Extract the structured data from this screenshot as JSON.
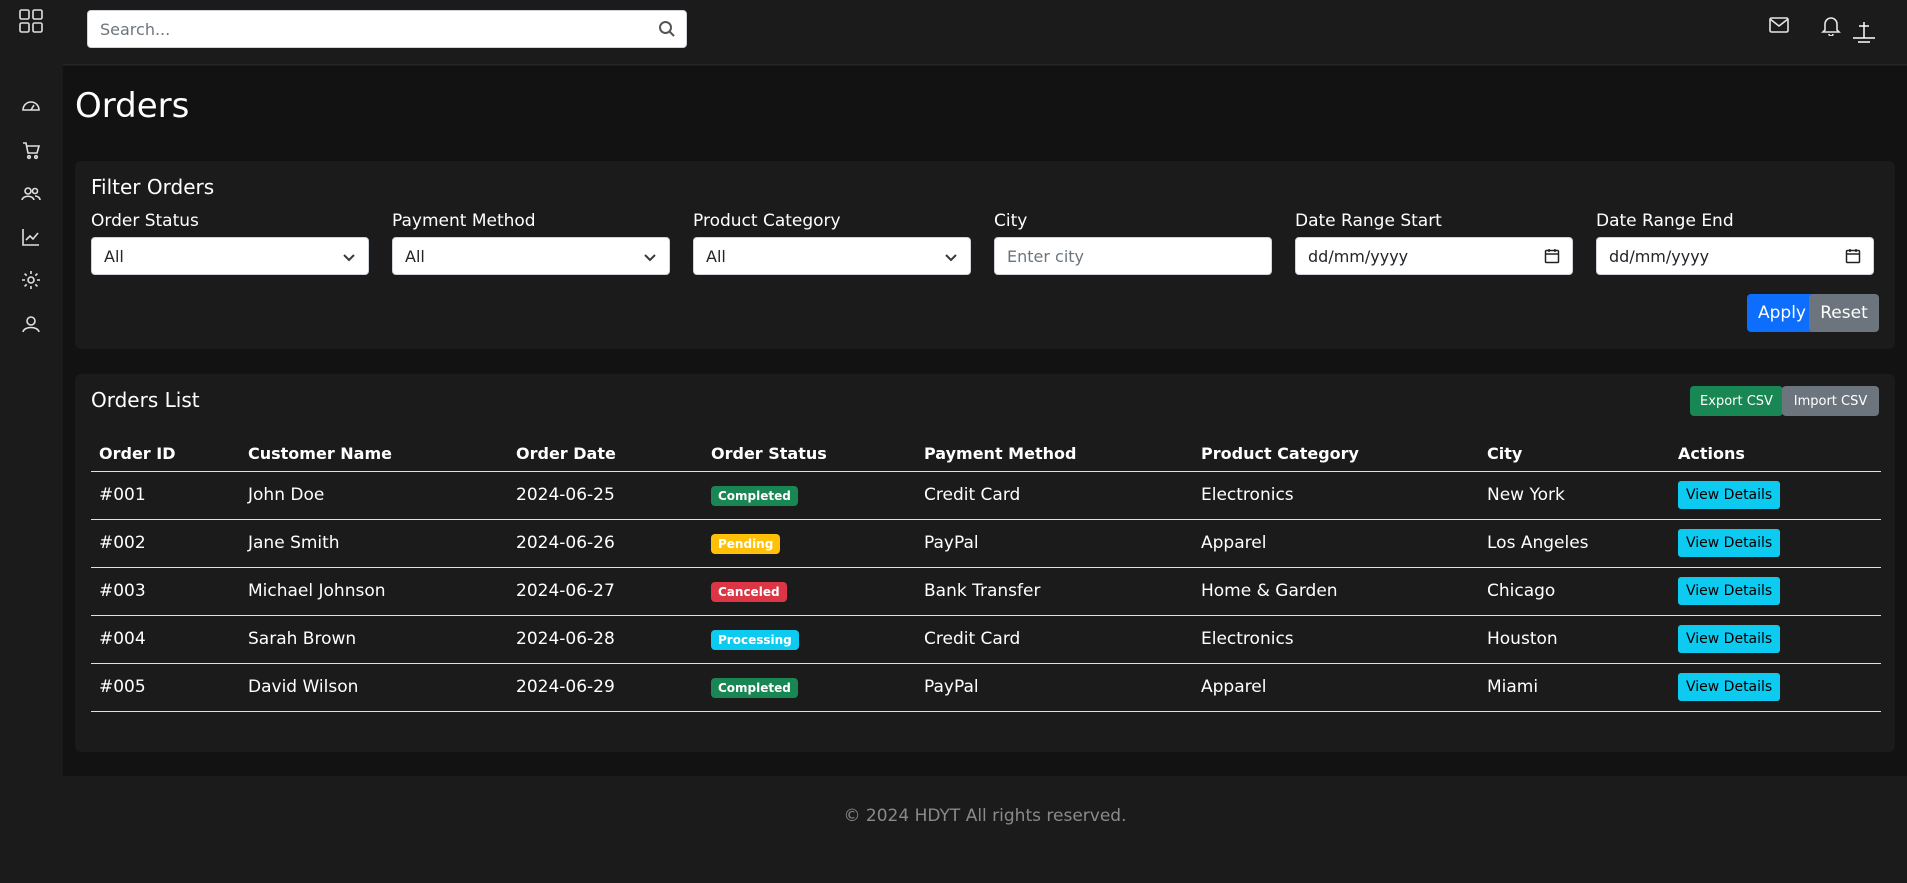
{
  "search": {
    "placeholder": "Search..."
  },
  "page": {
    "title": "Orders"
  },
  "filters": {
    "title": "Filter Orders",
    "order_status": {
      "label": "Order Status",
      "value": "All"
    },
    "payment_method": {
      "label": "Payment Method",
      "value": "All"
    },
    "product_category": {
      "label": "Product Category",
      "value": "All"
    },
    "city": {
      "label": "City",
      "placeholder": "Enter city"
    },
    "date_start": {
      "label": "Date Range Start",
      "placeholder": "dd/mm/yyyy"
    },
    "date_end": {
      "label": "Date Range End",
      "placeholder": "dd/mm/yyyy"
    },
    "apply_label": "Apply",
    "reset_label": "Reset"
  },
  "orders": {
    "title": "Orders List",
    "export_label": "Export CSV",
    "import_label": "Import CSV",
    "columns": [
      "Order ID",
      "Customer Name",
      "Order Date",
      "Order Status",
      "Payment Method",
      "Product Category",
      "City",
      "Actions"
    ],
    "rows": [
      {
        "id": "#001",
        "customer": "John Doe",
        "date": "2024-06-25",
        "status": "Completed",
        "payment": "Credit Card",
        "category": "Electronics",
        "city": "New York",
        "action": "View Details"
      },
      {
        "id": "#002",
        "customer": "Jane Smith",
        "date": "2024-06-26",
        "status": "Pending",
        "payment": "PayPal",
        "category": "Apparel",
        "city": "Los Angeles",
        "action": "View Details"
      },
      {
        "id": "#003",
        "customer": "Michael Johnson",
        "date": "2024-06-27",
        "status": "Canceled",
        "payment": "Bank Transfer",
        "category": "Home & Garden",
        "city": "Chicago",
        "action": "View Details"
      },
      {
        "id": "#004",
        "customer": "Sarah Brown",
        "date": "2024-06-28",
        "status": "Processing",
        "payment": "Credit Card",
        "category": "Electronics",
        "city": "Houston",
        "action": "View Details"
      },
      {
        "id": "#005",
        "customer": "David Wilson",
        "date": "2024-06-29",
        "status": "Completed",
        "payment": "PayPal",
        "category": "Apparel",
        "city": "Miami",
        "action": "View Details"
      }
    ]
  },
  "footer": {
    "text": "© 2024 HDYT All rights reserved."
  },
  "colors": {
    "primary": "#0d6efd",
    "success": "#198754",
    "warning": "#ffc107",
    "danger": "#dc3545",
    "info": "#0dcaf0",
    "secondary": "#6c757d"
  },
  "icons": {
    "sidebar": [
      "grid-icon",
      "dashboard-icon",
      "cart-icon",
      "users-icon",
      "chart-icon",
      "gear-icon",
      "user-icon"
    ],
    "topbar": [
      "mail-icon",
      "bell-icon"
    ]
  }
}
